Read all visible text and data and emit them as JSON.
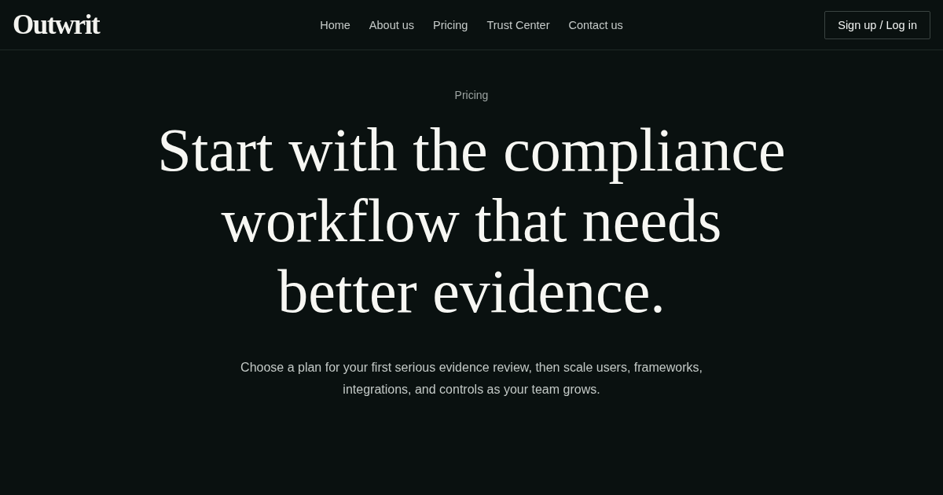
{
  "header": {
    "logo": "Outwrit",
    "nav": [
      {
        "label": "Home"
      },
      {
        "label": "About us"
      },
      {
        "label": "Pricing"
      },
      {
        "label": "Trust Center"
      },
      {
        "label": "Contact us"
      }
    ],
    "auth_button": "Sign up / Log in"
  },
  "hero": {
    "eyebrow": "Pricing",
    "headline": "Start with the compliance workflow that needs better evidence.",
    "subtitle": "Choose a plan for your first serious evidence review, then scale users, frameworks, integrations, and controls as your team grows."
  }
}
